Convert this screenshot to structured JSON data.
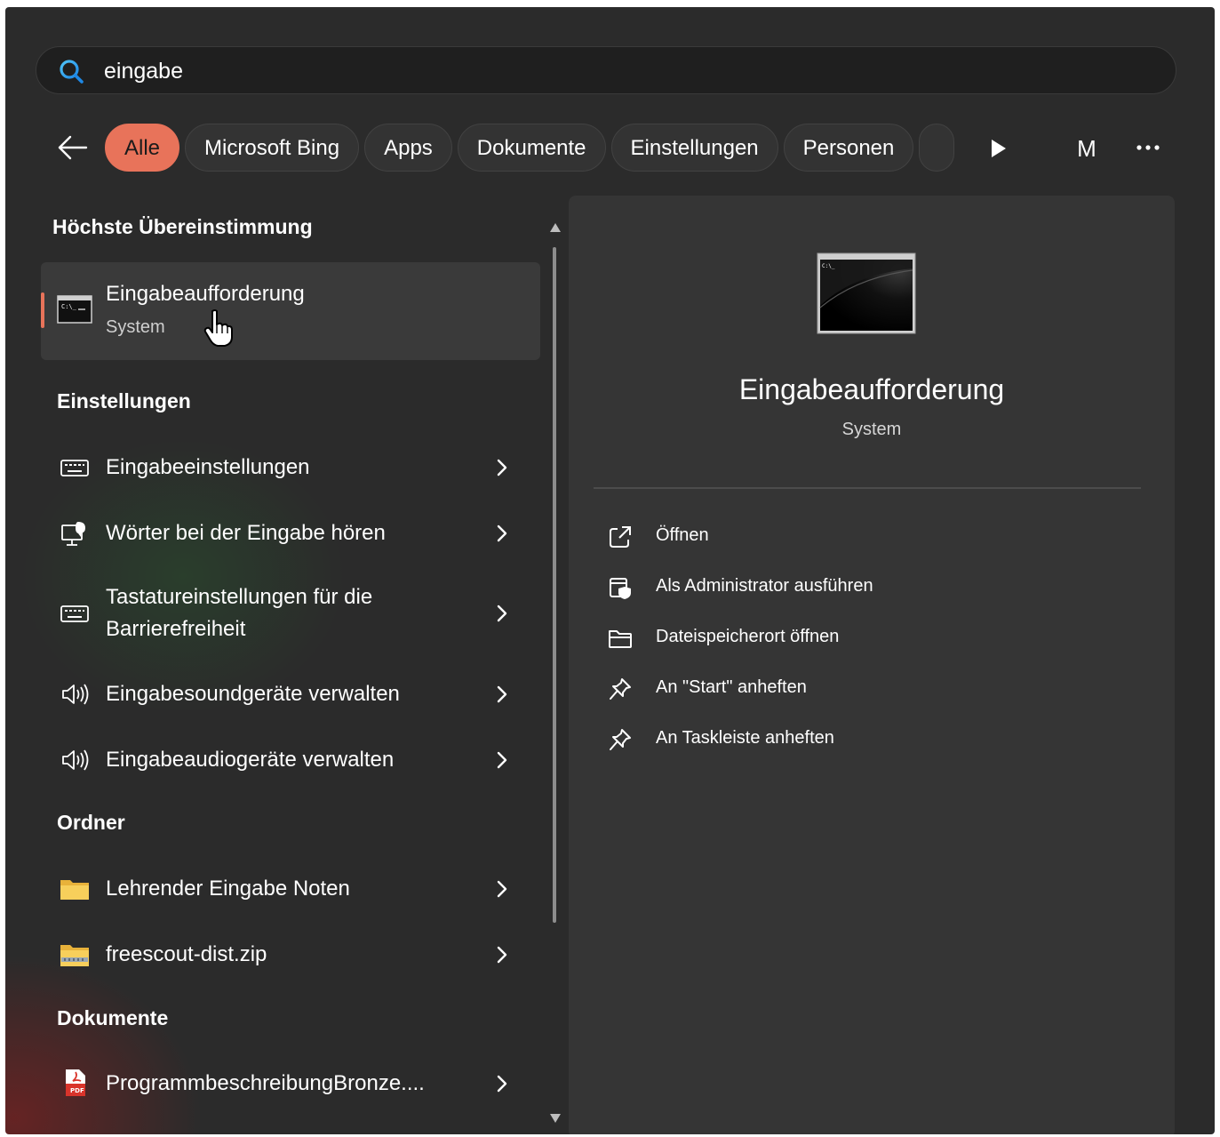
{
  "search": {
    "value": "eingabe",
    "placeholder": ""
  },
  "filters": {
    "pills": [
      "Alle",
      "Microsoft Bing",
      "Apps",
      "Dokumente",
      "Einstellungen",
      "Personen"
    ],
    "avatar_initial": "M"
  },
  "best_match": {
    "header": "Höchste Übereinstimmung",
    "title": "Eingabeaufforderung",
    "subtitle": "System",
    "icon": "cmd-terminal-icon"
  },
  "settings": {
    "header": "Einstellungen",
    "items": [
      {
        "label": "Eingabeeinstellungen",
        "icon": "keyboard-icon"
      },
      {
        "label": "Wörter bei der Eingabe hören",
        "icon": "narrator-icon"
      },
      {
        "label_line1": "Tastatureinstellungen für die",
        "label_line2": "Barrierefreiheit",
        "icon": "keyboard-icon"
      },
      {
        "label": "Eingabesoundgeräte verwalten",
        "icon": "speaker-icon"
      },
      {
        "label": "Eingabeaudiogeräte verwalten",
        "icon": "speaker-icon"
      }
    ]
  },
  "folders": {
    "header": "Ordner",
    "items": [
      {
        "label": "Lehrender Eingabe Noten",
        "icon": "folder-icon"
      },
      {
        "label": "freescout-dist.zip",
        "icon": "zip-folder-icon"
      }
    ]
  },
  "documents": {
    "header": "Dokumente",
    "items": [
      {
        "label": "ProgrammbeschreibungBronze....",
        "icon": "pdf-icon"
      }
    ]
  },
  "detail": {
    "title": "Eingabeaufforderung",
    "subtitle": "System",
    "actions": [
      {
        "label": "Öffnen",
        "icon": "open-external-icon"
      },
      {
        "label": "Als Administrator ausführen",
        "icon": "shield-admin-icon"
      },
      {
        "label": "Dateispeicherort öffnen",
        "icon": "folder-open-icon"
      },
      {
        "label": "An \"Start\" anheften",
        "icon": "pin-icon"
      },
      {
        "label": "An Taskleiste anheften",
        "icon": "pin-icon"
      }
    ]
  },
  "colors": {
    "accent": "#e8735a",
    "background": "#2b2b2b",
    "panel": "#353535",
    "search_bg": "#1f1f1f"
  }
}
